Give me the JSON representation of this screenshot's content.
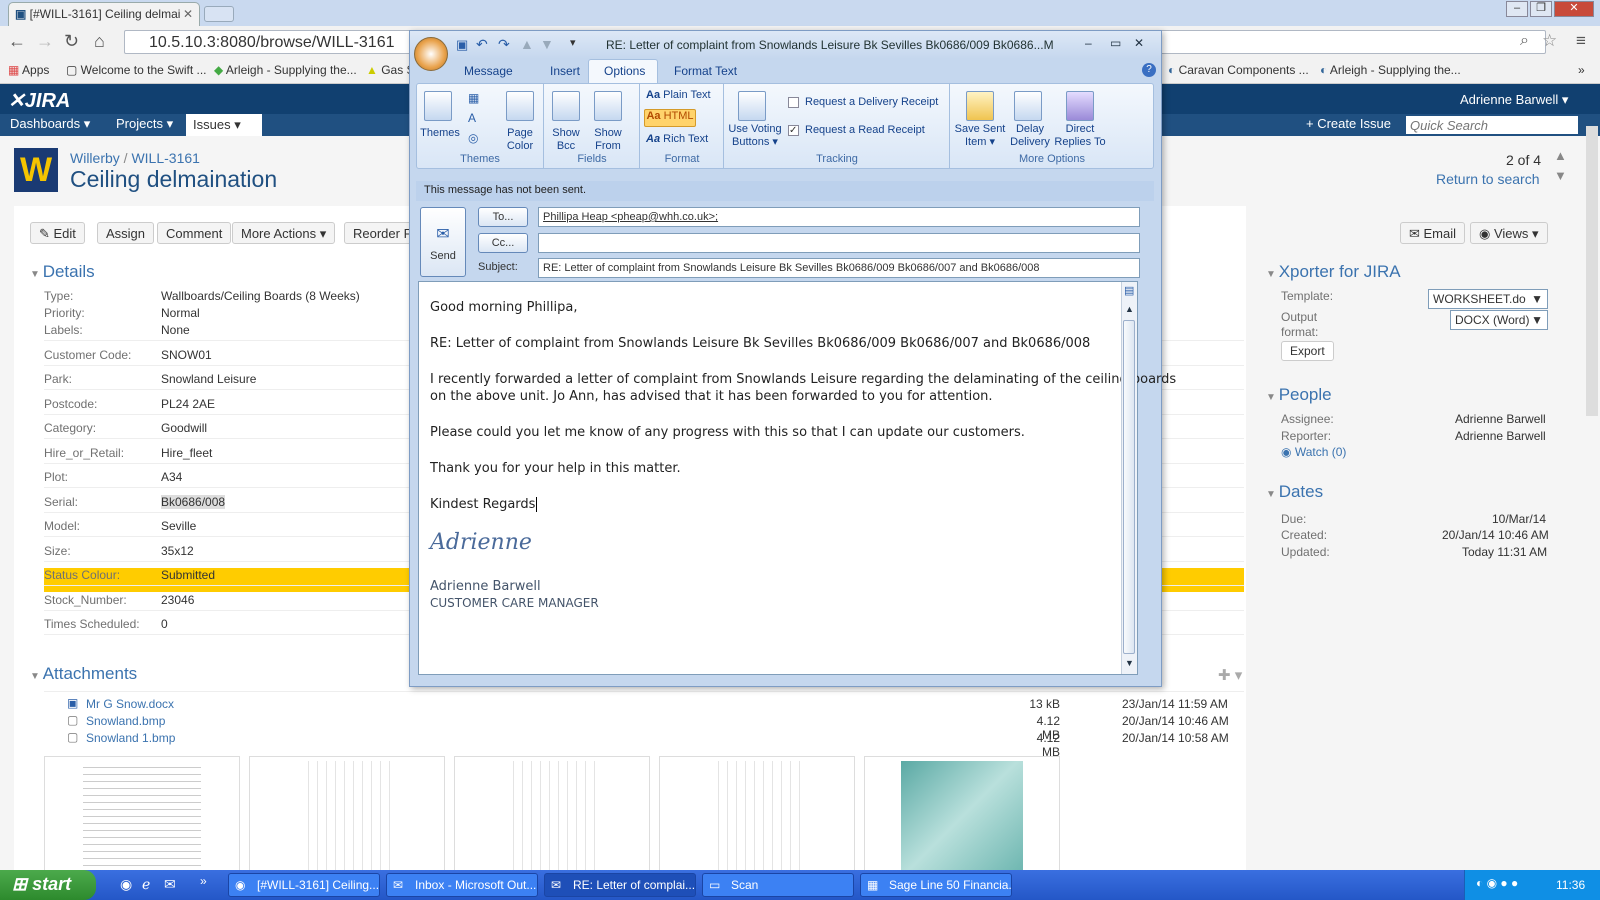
{
  "browser": {
    "tab_title": "[#WILL-3161] Ceiling delmai",
    "url": "10.5.10.3:8080/browse/WILL-3161",
    "bookmarks": [
      "Apps",
      "Welcome to the Swift ...",
      "Arleigh - Supplying the...",
      "Gas S",
      "Caravan Components ...",
      "Arleigh - Supplying the..."
    ]
  },
  "jira": {
    "logo": "JIRA",
    "user": "Adrienne Barwell",
    "nav": {
      "dashboards": "Dashboards",
      "projects": "Projects",
      "issues": "Issues",
      "create": "Create Issue",
      "search_placeholder": "Quick Search"
    },
    "breadcrumb": {
      "project": "Willerby",
      "sep": "/",
      "key": "WILL-3161"
    },
    "title": "Ceiling delmaination",
    "pager": "2 of 4",
    "return": "Return to search",
    "actions": {
      "edit": "Edit",
      "assign": "Assign",
      "comment": "Comment",
      "more": "More Actions",
      "reorder": "Reorder P",
      "email": "Email",
      "views": "Views"
    },
    "details_title": "Details",
    "details": [
      {
        "label": "Type:",
        "value": "Wallboards/Ceiling Boards (8 Weeks)"
      },
      {
        "label": "Priority:",
        "value": "Normal"
      },
      {
        "label": "Labels:",
        "value": "None"
      },
      {
        "label": "Customer Code:",
        "value": "SNOW01"
      },
      {
        "label": "Park:",
        "value": "Snowland Leisure"
      },
      {
        "label": "Postcode:",
        "value": "PL24 2AE"
      },
      {
        "label": "Category:",
        "value": "Goodwill"
      },
      {
        "label": "Hire_or_Retail:",
        "value": "Hire_fleet"
      },
      {
        "label": "Plot:",
        "value": "A34"
      },
      {
        "label": "Serial:",
        "value": "Bk0686/008"
      },
      {
        "label": "Model:",
        "value": "Seville"
      },
      {
        "label": "Size:",
        "value": "35x12"
      },
      {
        "label": "Status Colour:",
        "value": "Submitted"
      },
      {
        "label": "Stock_Number:",
        "value": "23046"
      },
      {
        "label": "Times Scheduled:",
        "value": "0"
      }
    ],
    "attachments_title": "Attachments",
    "attachments": [
      {
        "name": "Mr G Snow.docx",
        "size": "13 kB",
        "date": "23/Jan/14 11:59 AM"
      },
      {
        "name": "Snowland.bmp",
        "size": "4.12 MB",
        "date": "20/Jan/14 10:46 AM"
      },
      {
        "name": "Snowland 1.bmp",
        "size": "4.12 MB",
        "date": "20/Jan/14 10:58 AM"
      }
    ],
    "xporter": {
      "title": "Xporter for JIRA",
      "template_label": "Template:",
      "template_value": "WORKSHEET.do",
      "output_label1": "Output",
      "output_label2": "format:",
      "output_value": "DOCX (Word)",
      "export": "Export"
    },
    "people": {
      "title": "People",
      "assignee_label": "Assignee:",
      "assignee": "Adrienne Barwell",
      "reporter_label": "Reporter:",
      "reporter": "Adrienne Barwell",
      "watch": "Watch (0)"
    },
    "dates": {
      "title": "Dates",
      "due_label": "Due:",
      "due": "10/Mar/14",
      "created_label": "Created:",
      "created": "20/Jan/14 10:46 AM",
      "updated_label": "Updated:",
      "updated": "Today 11:31 AM"
    },
    "status_color": "#ffcc00",
    "accent": "#3b73af"
  },
  "outlook": {
    "title": "RE: Letter of complaint from Snowlands Leisure Bk Sevilles Bk0686/009 Bk0686...M",
    "tabs": [
      "Message",
      "Insert",
      "Options",
      "Format Text"
    ],
    "ribbon": {
      "themes": "Themes",
      "page_color1": "Page",
      "page_color2": "Color",
      "show_bcc1": "Show",
      "show_bcc2": "Bcc",
      "show_from1": "Show",
      "show_from2": "From",
      "plain": "Plain Text",
      "html": "HTML",
      "rich": "Rich Text",
      "voting1": "Use Voting",
      "voting2": "Buttons",
      "delivery": "Request a Delivery Receipt",
      "read": "Request a Read Receipt",
      "save1": "Save Sent",
      "save2": "Item",
      "delay1": "Delay",
      "delay2": "Delivery",
      "direct1": "Direct",
      "direct2": "Replies To",
      "g_themes": "Themes",
      "g_fields": "Fields",
      "g_format": "Format",
      "g_tracking": "Tracking",
      "g_more": "More Options"
    },
    "not_sent": "This message has not been sent.",
    "send": "Send",
    "to_btn": "To...",
    "cc_btn": "Cc...",
    "subject_label": "Subject:",
    "to": "Phillipa Heap <pheap@whh.co.uk>;",
    "cc": "",
    "subject": "RE: Letter of complaint from Snowlands Leisure Bk Sevilles Bk0686/009 Bk0686/007 and Bk0686/008",
    "body": {
      "greet": "Good morning Phillipa,",
      "re": "RE: Letter of complaint from Snowlands Leisure Bk Sevilles Bk0686/009 Bk0686/007 and Bk0686/008",
      "p1a": "I recently forwarded a letter of complaint from Snowlands Leisure regarding the delaminating of the ceiling boards",
      "p1b": "on the above unit. Jo Ann, has advised that it has been forwarded to you for attention.",
      "p2": "Please could you let me know of any progress with this so that I can update our customers.",
      "p3": "Thank you for your help in this matter.",
      "regards": "Kindest Regards",
      "sig_script": "Adrienne",
      "sig_name": "Adrienne Barwell",
      "sig_title": "CUSTOMER CARE MANAGER"
    }
  },
  "taskbar": {
    "start": "start",
    "items": [
      "[#WILL-3161] Ceiling...",
      "Inbox - Microsoft Out...",
      "RE: Letter of complai...",
      "Scan",
      "Sage Line 50 Financia..."
    ],
    "clock": "11:36"
  }
}
